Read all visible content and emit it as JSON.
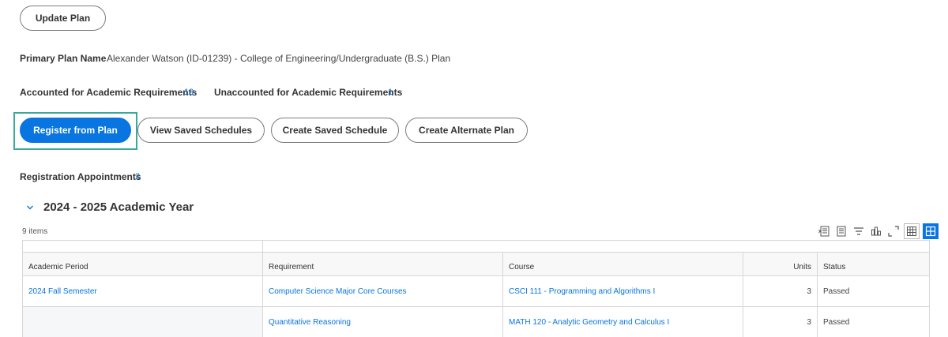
{
  "buttons": {
    "update_plan": "Update Plan",
    "register_from_plan": "Register from Plan",
    "view_saved_schedules": "View Saved Schedules",
    "create_saved_schedule": "Create Saved Schedule",
    "create_alternate_plan": "Create Alternate Plan"
  },
  "plan": {
    "primary_label": "Primary Plan Name",
    "primary_value": "Alexander Watson (ID-01239) - College of Engineering/Undergraduate (B.S.) Plan"
  },
  "requirements": {
    "accounted_label": "Accounted for Academic Requirements",
    "accounted_count": "19",
    "unaccounted_label": "Unaccounted for Academic Requirements",
    "unaccounted_count": "1"
  },
  "appointments": {
    "label": "Registration Appointments",
    "count": "2"
  },
  "section": {
    "title": "2024 - 2025 Academic Year",
    "items_count": "9 items"
  },
  "toolbar": {
    "icons": [
      "export-excel-icon",
      "export-pdf-icon",
      "filter-icon",
      "chart-icon",
      "fullscreen-icon",
      "table-view-icon",
      "grid-view-icon"
    ]
  },
  "table": {
    "headers": {
      "period": "Academic Period",
      "requirement": "Requirement",
      "course": "Course",
      "units": "Units",
      "status": "Status"
    },
    "rows": [
      {
        "period": "2024 Fall Semester",
        "requirement": "Computer Science Major Core Courses",
        "course": "CSCI 111 - Programming and Algorithms I",
        "units": "3",
        "status": "Passed"
      },
      {
        "period": "",
        "requirement": "Quantitative Reasoning",
        "course": "MATH 120 - Analytic Geometry and Calculus I",
        "units": "3",
        "status": "Passed"
      }
    ]
  },
  "colors": {
    "primary": "#0875e1",
    "focus": "#3aa89a",
    "border": "#d7d7d7"
  }
}
